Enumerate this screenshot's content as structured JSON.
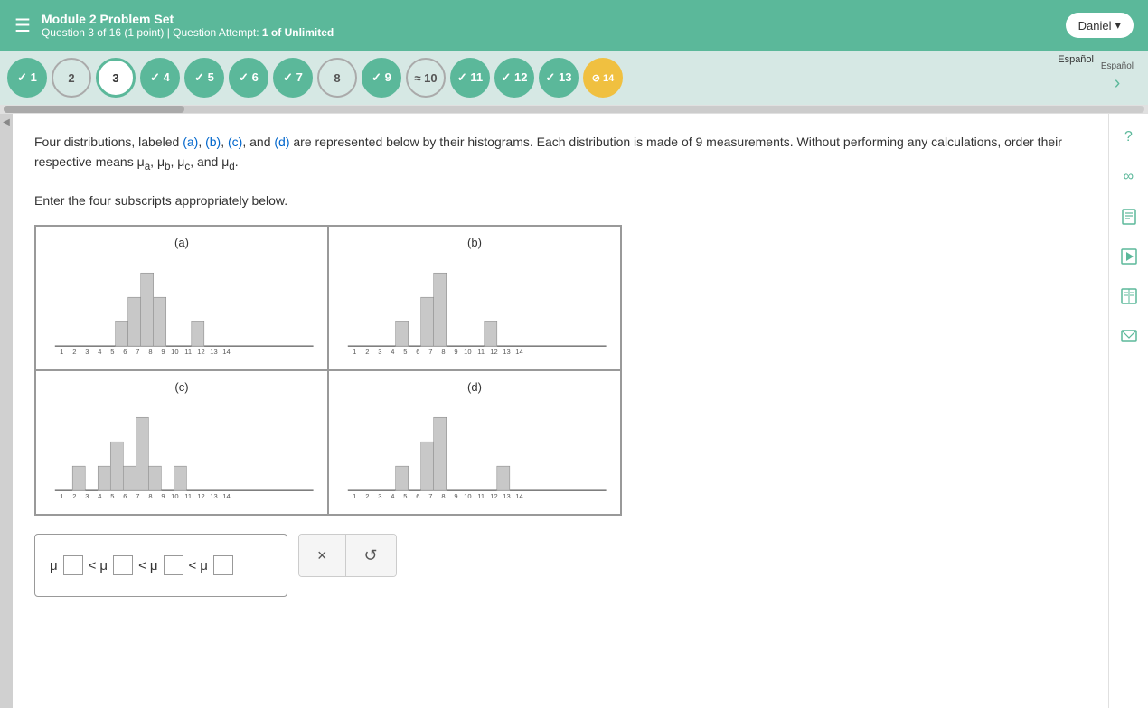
{
  "header": {
    "hamburger_icon": "☰",
    "module_title": "Module 2 Problem Set",
    "question_info": "Question 3 of 16",
    "point_info": "(1 point)",
    "separator": "|",
    "attempt_label": "Question Attempt:",
    "attempt_value": "1 of Unlimited",
    "user_name": "Daniel",
    "chevron_down": "▾"
  },
  "nav": {
    "espanol_label": "Español",
    "items": [
      {
        "label": "✓ 1",
        "state": "completed"
      },
      {
        "label": "2",
        "state": "incomplete"
      },
      {
        "label": "3",
        "state": "current"
      },
      {
        "label": "✓ 4",
        "state": "completed"
      },
      {
        "label": "✓ 5",
        "state": "completed"
      },
      {
        "label": "✓ 6",
        "state": "completed"
      },
      {
        "label": "✓ 7",
        "state": "completed"
      },
      {
        "label": "8",
        "state": "incomplete"
      },
      {
        "label": "✓ 9",
        "state": "completed"
      },
      {
        "label": "≈ 10",
        "state": "tilde"
      },
      {
        "label": "✓ 11",
        "state": "completed"
      },
      {
        "label": "✓ 12",
        "state": "completed"
      },
      {
        "label": "✓ 13",
        "state": "completed"
      },
      {
        "label": "⊘ 14",
        "state": "yellow"
      }
    ],
    "arrow_right": "›"
  },
  "question": {
    "text_part1": "Four distributions, labeled",
    "ref_a": "(a)",
    "comma1": ",",
    "ref_b": "(b)",
    "comma2": ",",
    "ref_c": "(c)",
    "and": "and",
    "ref_d": "(d)",
    "text_part2": "are represented below by their histograms. Each distribution is made of 9 measurements. Without performing any calculations, order their respective means μ",
    "sub_a": "a",
    "comma3": ", μ",
    "sub_b": "b",
    "comma4": ", μ",
    "sub_c": "c",
    "comma5": ", and μ",
    "sub_d": "d",
    "text_part3": ".",
    "enter_text": "Enter the four subscripts appropriately below."
  },
  "histograms": [
    {
      "id": "a",
      "title": "(a)",
      "bars": [
        0,
        0,
        0,
        0,
        1,
        2,
        3,
        2,
        0,
        0,
        1,
        0,
        0,
        0
      ],
      "x_labels": [
        "1",
        "2",
        "3",
        "4",
        "5",
        "6",
        "7",
        "8",
        "9",
        "10",
        "11",
        "12",
        "13",
        "14"
      ]
    },
    {
      "id": "b",
      "title": "(b)",
      "bars": [
        0,
        0,
        0,
        1,
        0,
        2,
        3,
        0,
        0,
        0,
        1,
        0,
        0,
        0
      ],
      "x_labels": [
        "1",
        "2",
        "3",
        "4",
        "5",
        "6",
        "7",
        "8",
        "9",
        "10",
        "11",
        "12",
        "13",
        "14"
      ]
    },
    {
      "id": "c",
      "title": "(c)",
      "bars": [
        0,
        1,
        0,
        1,
        2,
        1,
        3,
        1,
        0,
        1,
        0,
        0,
        0,
        0
      ],
      "x_labels": [
        "1",
        "2",
        "3",
        "4",
        "5",
        "6",
        "7",
        "8",
        "9",
        "10",
        "11",
        "12",
        "13",
        "14"
      ]
    },
    {
      "id": "d",
      "title": "(d)",
      "bars": [
        0,
        0,
        0,
        1,
        0,
        2,
        3,
        0,
        0,
        0,
        0,
        1,
        0,
        0
      ],
      "x_labels": [
        "1",
        "2",
        "3",
        "4",
        "5",
        "6",
        "7",
        "8",
        "9",
        "10",
        "11",
        "12",
        "13",
        "14"
      ]
    }
  ],
  "answer": {
    "mu_symbol": "μ",
    "lt1": "<",
    "lt2": "<",
    "lt3": "<"
  },
  "actions": {
    "clear_icon": "×",
    "reset_icon": "↺"
  },
  "sidebar_icons": {
    "help": "?",
    "infinity": "∞",
    "note": "🗒",
    "play": "▶",
    "book": "📖",
    "mail": "✉"
  }
}
